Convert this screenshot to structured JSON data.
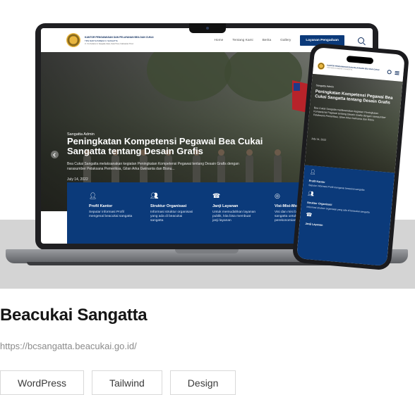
{
  "project": {
    "title": "Beacukai Sangatta",
    "url": "https://bcsangatta.beacukai.go.id/",
    "tags": [
      "WordPress",
      "Tailwind",
      "Design"
    ]
  },
  "site": {
    "brand_line1": "KANTOR PENGAWASAN DAN PELAYANAN BEA DAN CUKAI",
    "brand_line2": "TIPE MADYA PABEAN C SANGATTA",
    "brand_line3": "Jl. Yos Sudarso II, Sangatta Utara, Kutai Timur, Kalimantan Timur",
    "nav": [
      "Home",
      "Tentang Kami",
      "Berita",
      "Gallery"
    ],
    "cta": "Layanan Pengaduan",
    "hero": {
      "kicker": "Sangatta Admin",
      "title": "Peningkatan Kompetensi Pegawai Bea Cukai Sangatta tentang Desain Grafis",
      "desc": "Bea Cukai Sangatta melaksanakan kegiatan Peningkatan Kompetensi Pegawai tentang Desain Grafis dengan narasumber Pelaksana Pemeriksa, Gilan Arka Gwinanta dan Bisnu...",
      "date": "July 14, 2022"
    },
    "services": [
      {
        "icon": "user-icon",
        "title": "Profil Kantor",
        "text": "Seputar informasi Profil mengenai beacukai sangatta"
      },
      {
        "icon": "users-icon",
        "title": "Struktur Organisasi",
        "text": "Informasi struktur organisasi yang ada di beacukai sangatta"
      },
      {
        "icon": "headset-icon",
        "title": "Janji Layanan",
        "text": "Untuk memudahkan layanan publik, kita bisa membuat janji layanan"
      },
      {
        "icon": "target-icon",
        "title": "Visi-Misi-Mo",
        "text": "Visi dan misi beacukai sangatta untuk perekonomian"
      }
    ]
  },
  "phone": {
    "kicker": "Sangatta Admin",
    "title": "Peningkatan Kompetensi Pegawai Bea Cukai Sangatta tentang Desain Grafis",
    "desc": "Bea Cukai Sangatta melaksanakan kegiatan Peningkatan Kompetensi Pegawai tentang Desain Grafis dengan narasumber Pelaksana Pemeriksa, Gilan Arka Gwinanta dan Bisnu",
    "date": "July 14, 2022",
    "services": [
      {
        "title": "Profil Kantor",
        "text": "Seputar informasi Profil mengenai beacukai sangatta"
      },
      {
        "title": "Struktur Organisasi",
        "text": "Informasi struktur organisasi yang ada di beacukai sangatta"
      },
      {
        "title": "Janji Layanan",
        "text": ""
      }
    ]
  },
  "colors": {
    "primary": "#0b3a7a",
    "band": "#d4d4d4",
    "title": "#151515",
    "url": "#8a8a8a"
  }
}
